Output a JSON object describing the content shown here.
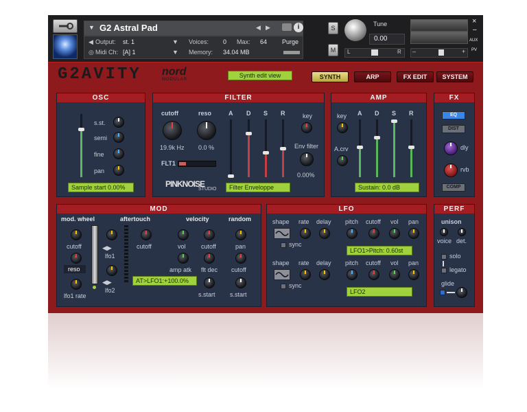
{
  "header": {
    "instrument_name": "G2 Astral Pad",
    "output_label": "Output:",
    "output_value": "st. 1",
    "voices_label": "Voices:",
    "voices_value": "0",
    "max_label": "Max:",
    "max_value": "64",
    "purge_label": "Purge",
    "midi_label": "Midi Ch:",
    "midi_value": "[A]  1",
    "memory_label": "Memory:",
    "memory_value": "34.04 MB",
    "tune_label": "Tune",
    "tune_value": "0.00",
    "solo_btn": "S",
    "mute_btn": "M",
    "pan_left": "L",
    "pan_right": "R",
    "aux_label": "AUX",
    "pv_label": "PV",
    "close_glyph": "×",
    "min_glyph": "–"
  },
  "brand": {
    "logo": "G2AVITY",
    "nord": "nord",
    "nord_sub": "MODULAR",
    "edit_view": "Synth edit view",
    "pinknoise": "PINKNOISE",
    "studio": "STUDIO"
  },
  "tabs": [
    {
      "label": "SYNTH",
      "active": true
    },
    {
      "label": "ARP",
      "active": false
    },
    {
      "label": "FX EDIT",
      "active": false
    },
    {
      "label": "SYSTEM",
      "active": false
    }
  ],
  "osc": {
    "title": "OSC",
    "knobs": [
      "s.st.",
      "semi",
      "fine",
      "pan"
    ],
    "display": "Sample start 0.00%"
  },
  "filter": {
    "title": "FILTER",
    "cutoff_label": "cutoff",
    "reso_label": "reso",
    "cutoff_value": "19.9k Hz",
    "reso_value": "0.0 %",
    "type_label": "FLT1",
    "adsr": [
      "A",
      "D",
      "S",
      "R"
    ],
    "key_label": "key",
    "env_label": "Env filter",
    "env_value": "0.00%",
    "display": "Filter Enveloppe"
  },
  "amp": {
    "title": "AMP",
    "key_label": "key",
    "acrv_label": "A.crv",
    "adsr": [
      "A",
      "D",
      "S",
      "R"
    ],
    "display": "Sustain: 0.0 dB"
  },
  "fx": {
    "title": "FX",
    "eq": "EQ",
    "dist": "DIST",
    "dly": "dly",
    "rvb": "rvb",
    "comp": "COMP"
  },
  "mod": {
    "title": "MOD",
    "mod_wheel": "mod. wheel",
    "aftertouch": "aftertouch",
    "velocity": "velocity",
    "random": "random",
    "cutoff": "cutoff",
    "reso": "reso",
    "lfo1_rate": "lfo1 rate",
    "lfo1": "lfo1",
    "lfo2": "lfo2",
    "at_cutoff": "cutoff",
    "display": "AT>LFO1:+100.0%",
    "vol": "vol",
    "vel_cutoff": "cutoff",
    "amp_atk": "amp atk",
    "flt_dec": "flt dec",
    "s_start": "s.start",
    "rnd_pan": "pan",
    "rnd_cutoff": "cutoff",
    "rnd_sstart": "s.start"
  },
  "lfo": {
    "title": "LFO",
    "shape": "shape",
    "rate": "rate",
    "delay": "delay",
    "sync": "sync",
    "dests": [
      "pitch",
      "cutoff",
      "vol",
      "pan"
    ],
    "display1": "LFO1>Pitch: 0.60st",
    "display2": "LFO2"
  },
  "perf": {
    "title": "PERF",
    "unison": "unison",
    "voice": "voice",
    "det": "det.",
    "solo": "solo",
    "legato": "legato",
    "glide": "glide"
  }
}
